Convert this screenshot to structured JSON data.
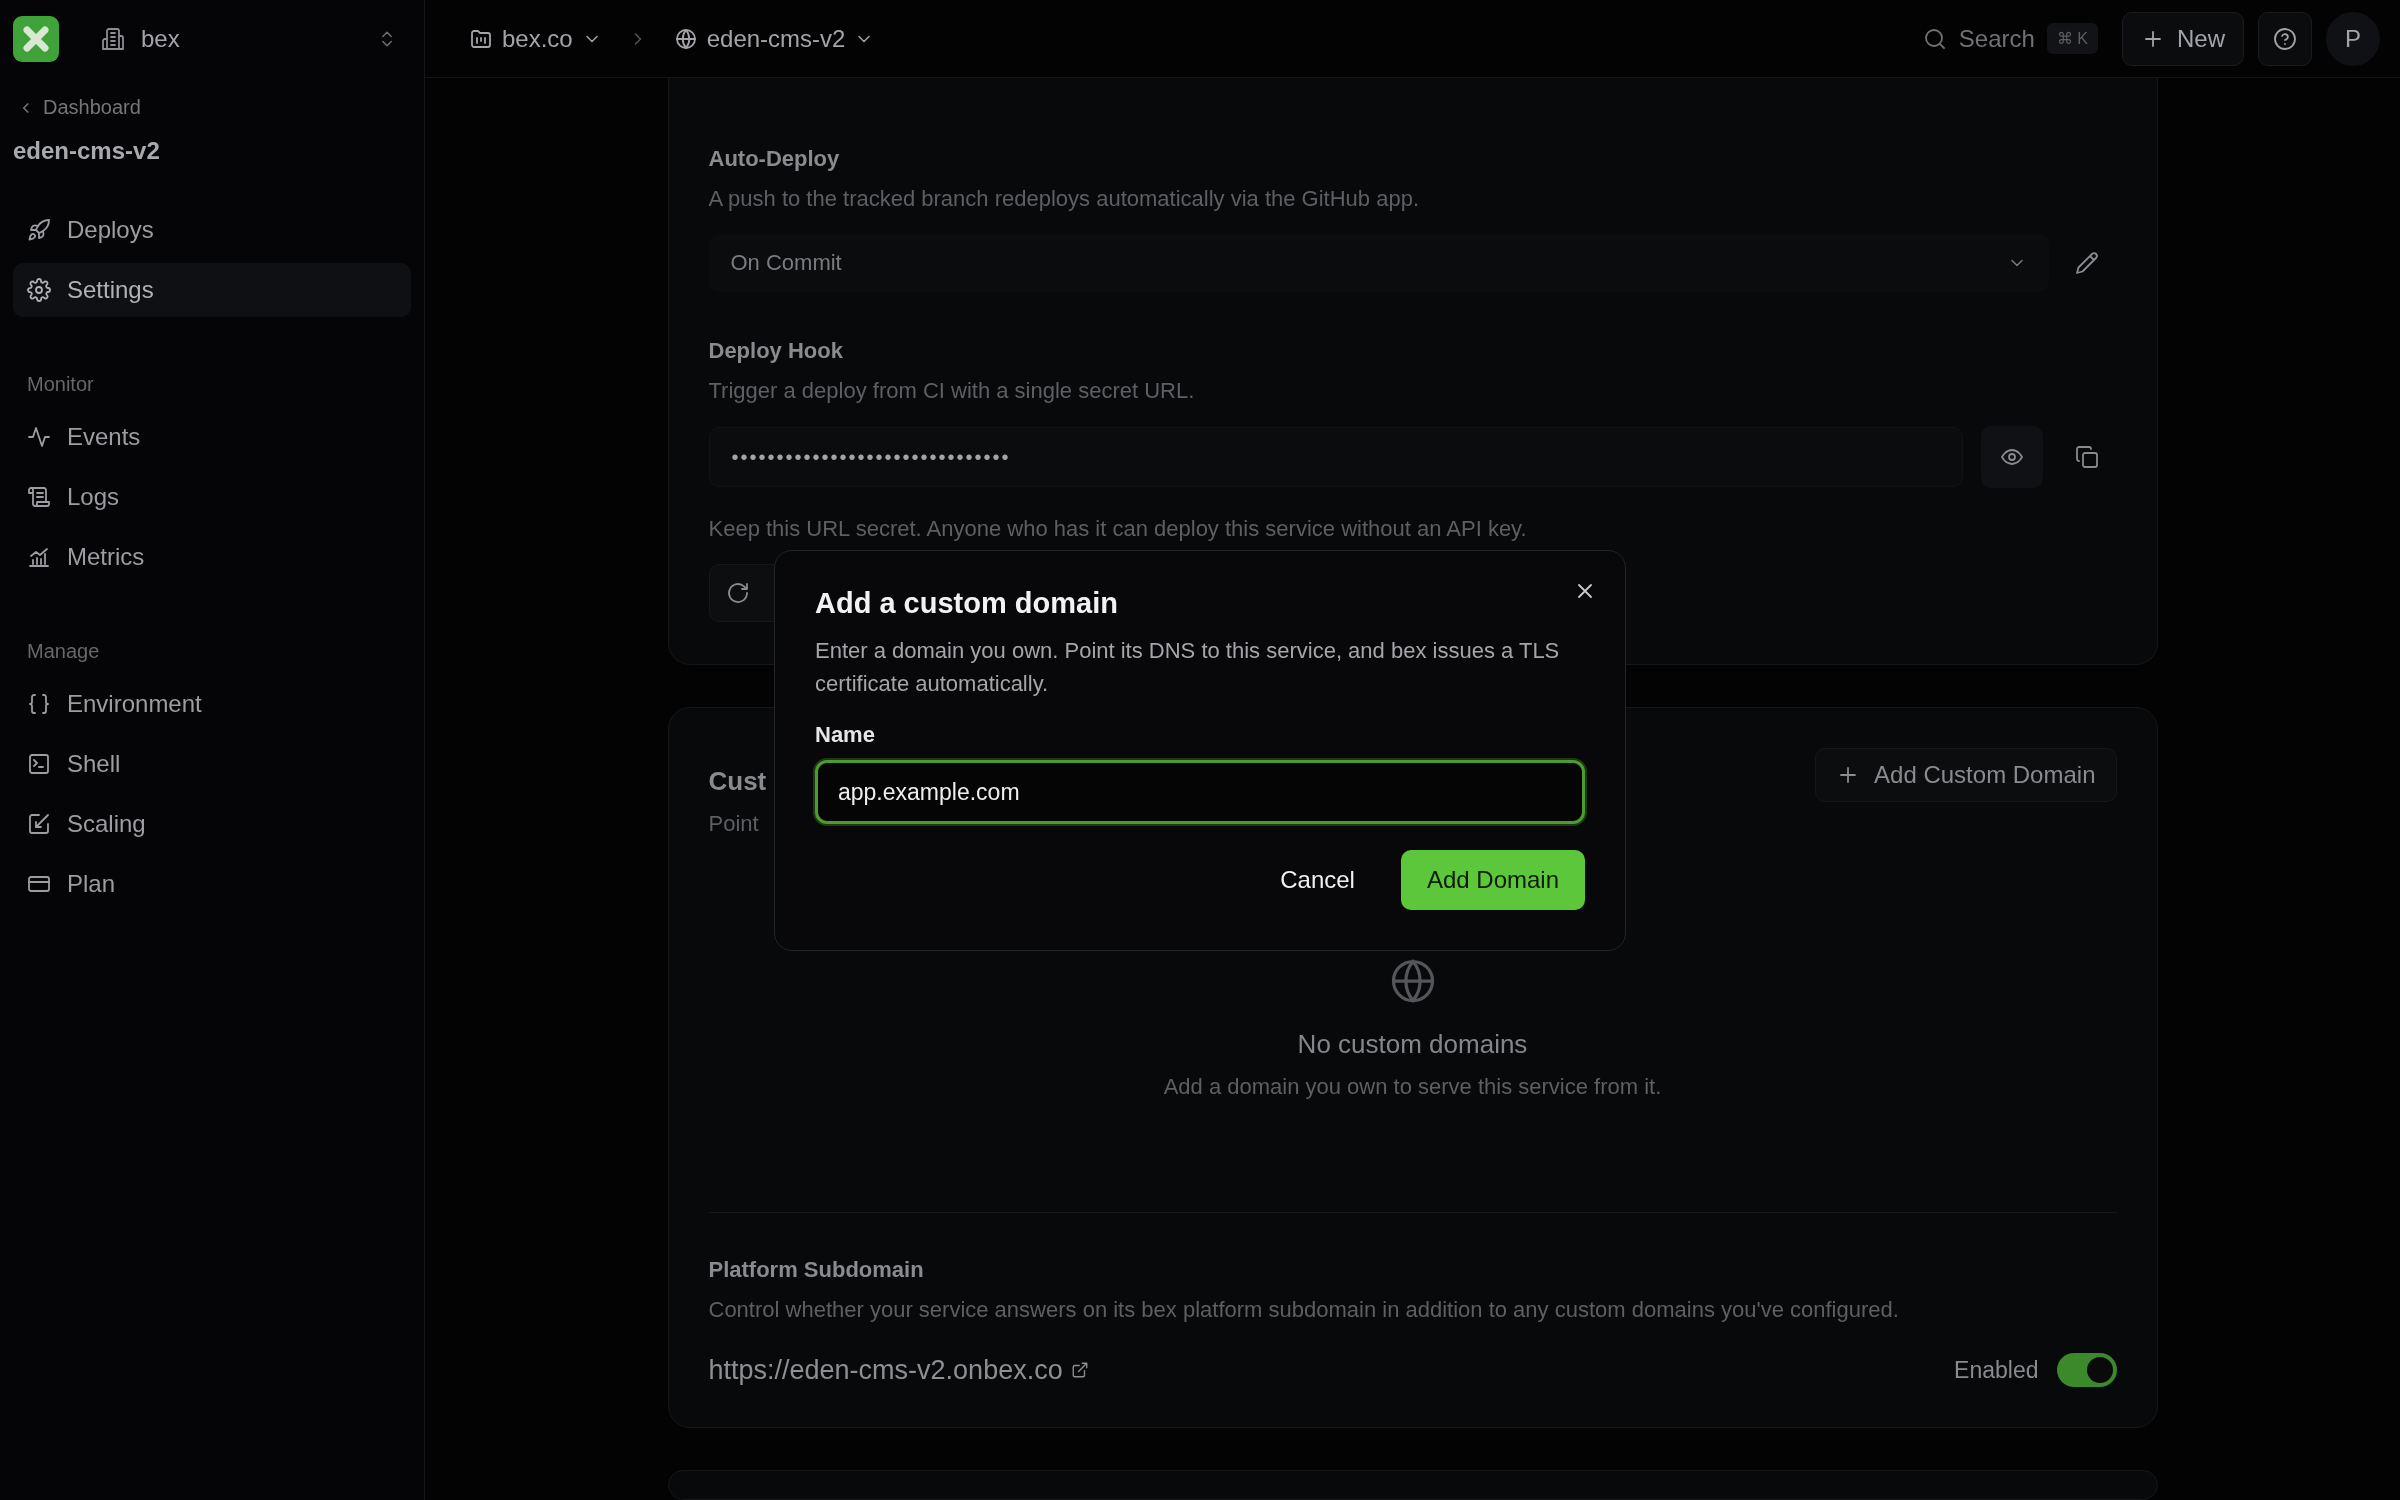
{
  "sidebar": {
    "workspace": "bex",
    "back_link": "Dashboard",
    "project": "eden-cms-v2",
    "items": [
      {
        "label": "Deploys",
        "selected": false
      },
      {
        "label": "Settings",
        "selected": true
      }
    ],
    "sections": [
      {
        "heading": "Monitor",
        "items": [
          {
            "label": "Events",
            "selected": false
          },
          {
            "label": "Logs",
            "selected": false
          },
          {
            "label": "Metrics",
            "selected": false
          }
        ]
      },
      {
        "heading": "Manage",
        "items": [
          {
            "label": "Environment",
            "selected": false
          },
          {
            "label": "Shell",
            "selected": false
          },
          {
            "label": "Scaling",
            "selected": false
          },
          {
            "label": "Plan",
            "selected": false
          }
        ]
      }
    ]
  },
  "topbar": {
    "breadcrumb": [
      {
        "label": "bex.co"
      },
      {
        "label": "eden-cms-v2"
      }
    ],
    "search": {
      "placeholder": "Search",
      "shortcut": "⌘ K"
    },
    "new_button": "New",
    "avatar": "P"
  },
  "auto_deploy": {
    "label": "Auto-Deploy",
    "description": "A push to the tracked branch redeploys automatically via the GitHub app.",
    "value": "On Commit"
  },
  "deploy_hook": {
    "label": "Deploy Hook",
    "description": "Trigger a deploy from CI with a single secret URL.",
    "value": "•••••••••••••••••••••••••••••••",
    "note": "Keep this URL secret. Anyone who has it can deploy this service without an API key."
  },
  "custom_domains": {
    "title": "Cust",
    "description": "Point",
    "button": "Add Custom Domain",
    "empty_title": "No custom domains",
    "empty_text": "Add a domain you own to serve this service from it."
  },
  "platform_subdomain": {
    "label": "Platform Subdomain",
    "description": "Control whether your service answers on its bex platform subdomain in addition to any custom domains you've configured.",
    "url": "https://eden-cms-v2.onbex.co",
    "toggle_label": "Enabled",
    "on": true
  },
  "modal": {
    "title": "Add a custom domain",
    "description": "Enter a domain you own. Point its DNS to this service, and bex issues a TLS certificate automatically.",
    "field_label": "Name",
    "value": "app.example.com",
    "cancel": "Cancel",
    "confirm": "Add Domain"
  }
}
